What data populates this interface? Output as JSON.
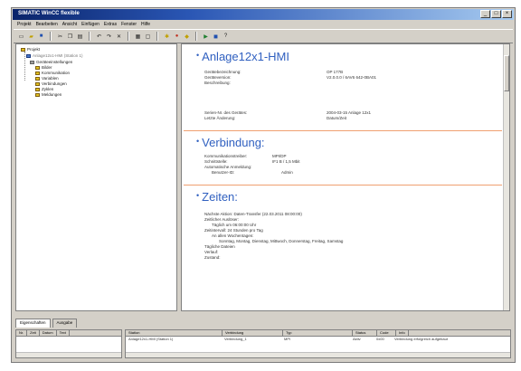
{
  "window": {
    "title": "SIMATIC WinCC flexible",
    "controls": [
      "_",
      "□",
      "×"
    ]
  },
  "menu": [
    "Projekt",
    "Bearbeiten",
    "Ansicht",
    "Einfügen",
    "Extras",
    "Fenster",
    "Hilfe"
  ],
  "tree": {
    "root": "Projekt",
    "items": [
      {
        "label": "Anlage12x1-HMI (Station 1)",
        "level": 1
      },
      {
        "label": "Geräteeinstellungen",
        "level": 2
      },
      {
        "label": "Bilder",
        "level": 3
      },
      {
        "label": "Kommunikation",
        "level": 3
      },
      {
        "label": "Variablen",
        "level": 3
      },
      {
        "label": "Verbindungen",
        "level": 3
      },
      {
        "label": "Zyklen",
        "level": 3
      },
      {
        "label": "Meldungen",
        "level": 3
      }
    ]
  },
  "detail": {
    "section1": {
      "title": "Anlage12x1-HMI",
      "rows": [
        {
          "label": "Gerätebezeichnung:",
          "value": "OP 177B"
        },
        {
          "label": "Geräteversion:",
          "value": "V2.0.0.0 / 6AV6 642-0BA01"
        },
        {
          "label": "Beschreibung:",
          "value": ""
        },
        {
          "label": "Serien-Nr. des Gerätes:",
          "value": "2004-03-15 Anlage 12x1"
        },
        {
          "label": "Letzte Änderung:",
          "value": "Datum/Zeit"
        }
      ]
    },
    "section2": {
      "title": "Verbindung:",
      "rows": [
        {
          "label": "Kommunikationstreiber:",
          "value": "MPI/DP"
        },
        {
          "label": "Schnittstelle:",
          "value": "IF1 B / 1,5 Mbit"
        },
        {
          "label": "Automatische Anmeldung:",
          "value": ""
        },
        {
          "label": "Benutzer-ID:",
          "value": "Admin"
        }
      ]
    },
    "section3": {
      "title": "Zeiten:",
      "rows": [
        "Nächste Aktion:   Daten-Transfer (22.03.2011 08:00:00)",
        "Zeitlicher Auslöser:",
        "Täglich um 06:00:00 Uhr",
        "Zeitintervall:   24 Stunden pro Tag",
        "An allen Wochentagen:",
        "Sonntag, Montag, Dienstag, Mittwoch, Donnerstag, Freitag, Samstag",
        "Tägliche Dateien",
        "Verlauf:",
        "Zustand:"
      ]
    }
  },
  "tabs": [
    "Eigenschaften",
    "Ausgabe"
  ],
  "bottom_left": {
    "headers": [
      "Nr.",
      "Zeit",
      "Datum",
      "Text"
    ],
    "rows": [
      [
        "",
        "",
        "",
        ""
      ]
    ]
  },
  "bottom_right": {
    "headers": [
      "Station",
      "Verbindung",
      "Typ",
      "Status",
      "Code",
      "Info"
    ],
    "rows": [
      [
        "Anlage12x1-HMI (Station 1)",
        "Verbindung_1",
        "MPI",
        "Aktiv",
        "0x00",
        "Verbindung erfolgreich aufgebaut"
      ]
    ]
  }
}
